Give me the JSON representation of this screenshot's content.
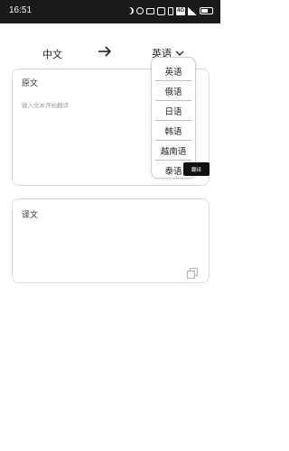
{
  "status_bar": {
    "time": "16:51",
    "network_label": "4G",
    "icons": [
      "moon-icon",
      "gear-icon",
      "mail-icon",
      "box-icon",
      "vibrate-icon",
      "network-icon",
      "signal-icon",
      "battery-icon"
    ]
  },
  "language_bar": {
    "source_language": "中文",
    "arrow_icon": "arrow-right-icon",
    "target_language": "英语",
    "chevron_icon": "chevron-down-icon"
  },
  "source_card": {
    "label": "原文",
    "placeholder": "输入文本开始翻译"
  },
  "translate_button": {
    "label": "翻译"
  },
  "language_dropdown": {
    "options": [
      "英语",
      "俄语",
      "日语",
      "韩语",
      "越南语",
      "泰语"
    ]
  },
  "result_card": {
    "label": "译文",
    "copy_icon": "copy-icon"
  }
}
